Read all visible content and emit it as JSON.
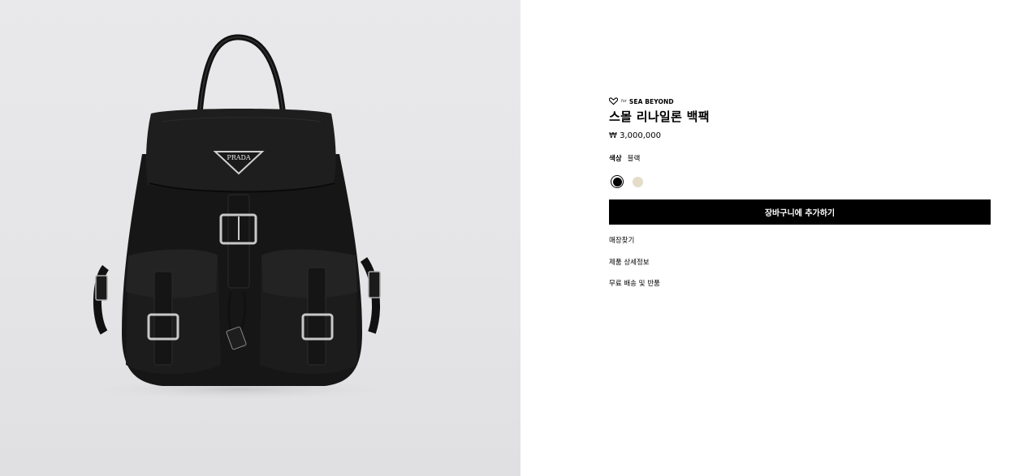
{
  "product": {
    "brand_for": "for",
    "brand_sea": "SEA BEYOND",
    "title": "스몰 리나일론 백팩",
    "price": "₩ 3,000,000",
    "logo_text": "PRADA"
  },
  "color": {
    "label": "색상",
    "selected_name": "블랙",
    "swatches": [
      {
        "name": "black",
        "hex": "#000000",
        "selected": true
      },
      {
        "name": "beige",
        "hex": "#e4dcc9",
        "selected": false
      }
    ]
  },
  "actions": {
    "add_to_cart": "장바구니에 추가하기"
  },
  "links": {
    "store_finder": "매장찾기",
    "product_details": "제품 상세정보",
    "shipping_returns": "무료 배송 및 반품"
  }
}
